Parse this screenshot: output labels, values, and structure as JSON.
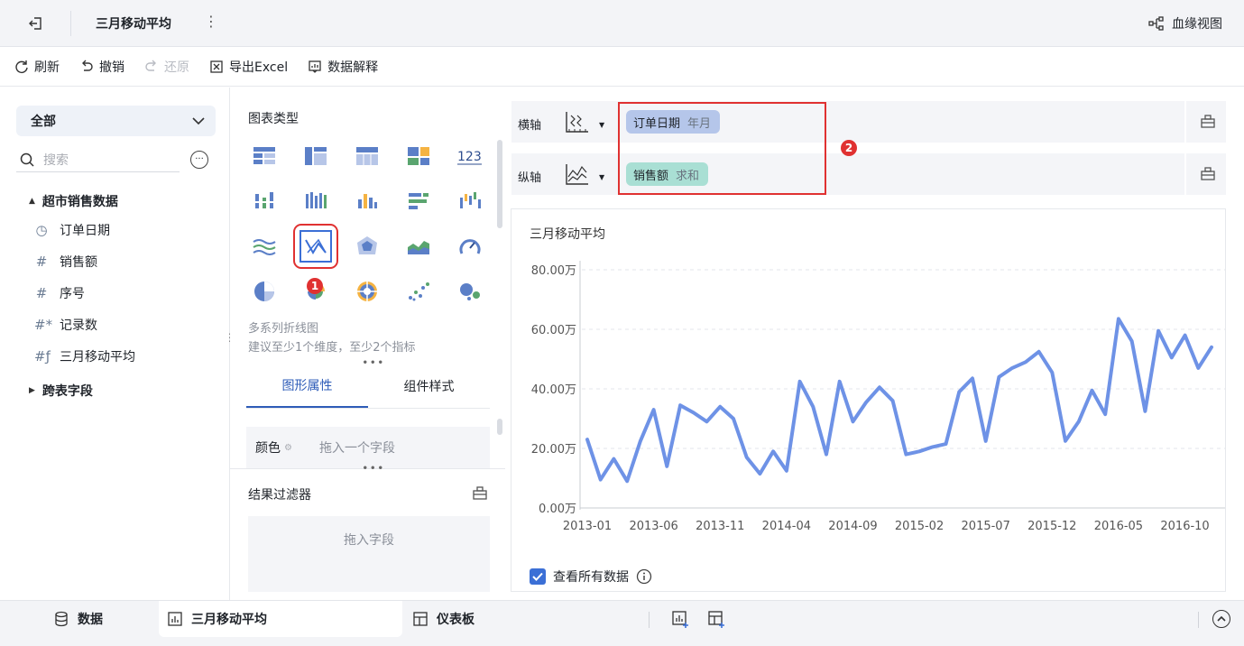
{
  "header": {
    "title": "三月移动平均",
    "more": "⋮",
    "lineage_label": "血缘视图"
  },
  "toolbar": {
    "refresh": "刷新",
    "undo": "撤销",
    "redo": "还原",
    "export_excel": "导出Excel",
    "data_explain": "数据解释"
  },
  "data_panel": {
    "scope": "全部",
    "search_placeholder": "搜索",
    "groups": [
      {
        "label": "超市销售数据",
        "expanded": true
      },
      {
        "label": "跨表字段",
        "expanded": false
      }
    ],
    "fields": [
      {
        "label": "订单日期",
        "icon": "clock-icon"
      },
      {
        "label": "销售额",
        "icon": "hash-icon"
      },
      {
        "label": "序号",
        "icon": "hash-icon"
      },
      {
        "label": "记录数",
        "icon": "hash-star-icon"
      },
      {
        "label": "三月移动平均",
        "icon": "hash-formula-icon"
      }
    ]
  },
  "chart_type_panel": {
    "title": "图表类型",
    "selected_badge": "1",
    "selected_name": "多系列折线图",
    "selected_hint": "建议至少1个维度，至少2个指标",
    "tabs": [
      "图形属性",
      "组件样式"
    ],
    "color_label": "颜色",
    "color_placeholder": "拖入一个字段",
    "filter_title": "结果过滤器",
    "filter_placeholder": "拖入字段"
  },
  "axes": {
    "x_label": "横轴",
    "y_label": "纵轴",
    "x_field": "订单日期",
    "x_agg": "年月",
    "y_field": "销售额",
    "y_agg": "求和",
    "badge": "2"
  },
  "chart": {
    "show_all_label": "查看所有数据"
  },
  "chart_data": {
    "type": "line",
    "title": "三月移动平均",
    "xlabel": "",
    "ylabel": "",
    "ylim": [
      0,
      80
    ],
    "yticks": [
      "0.00万",
      "20.00万",
      "40.00万",
      "60.00万",
      "80.00万"
    ],
    "ytick_values": [
      0,
      20,
      40,
      60,
      80
    ],
    "xticks": [
      "2013-01",
      "2013-06",
      "2013-11",
      "2014-04",
      "2014-09",
      "2015-02",
      "2015-07",
      "2015-12",
      "2016-05",
      "2016-10"
    ],
    "xtick_index": [
      0,
      5,
      10,
      15,
      20,
      25,
      30,
      35,
      40,
      45
    ],
    "grid": true,
    "color": "#6e92e6",
    "x": [
      "2013-01",
      "2013-02",
      "2013-03",
      "2013-04",
      "2013-05",
      "2013-06",
      "2013-07",
      "2013-08",
      "2013-09",
      "2013-10",
      "2013-11",
      "2013-12",
      "2014-01",
      "2014-02",
      "2014-03",
      "2014-04",
      "2014-05",
      "2014-06",
      "2014-07",
      "2014-08",
      "2014-09",
      "2014-10",
      "2014-11",
      "2014-12",
      "2015-01",
      "2015-02",
      "2015-03",
      "2015-04",
      "2015-05",
      "2015-06",
      "2015-07",
      "2015-08",
      "2015-09",
      "2015-10",
      "2015-11",
      "2015-12",
      "2016-01",
      "2016-02",
      "2016-03",
      "2016-04",
      "2016-05",
      "2016-06",
      "2016-07",
      "2016-08",
      "2016-09",
      "2016-10",
      "2016-11",
      "2016-12"
    ],
    "values": [
      23,
      9.5,
      16.5,
      9,
      22.5,
      33,
      14,
      34.5,
      32,
      29,
      34,
      30,
      17,
      11.5,
      19,
      12.5,
      42.5,
      34,
      18,
      42.5,
      29,
      35.5,
      40.5,
      36,
      18,
      19,
      20.5,
      21.5,
      39,
      43.5,
      22.5,
      44,
      47,
      49,
      52.5,
      45.5,
      22.5,
      29,
      39.5,
      31.5,
      63.5,
      56,
      32.5,
      59.5,
      50.5,
      58,
      47,
      54
    ]
  }
}
